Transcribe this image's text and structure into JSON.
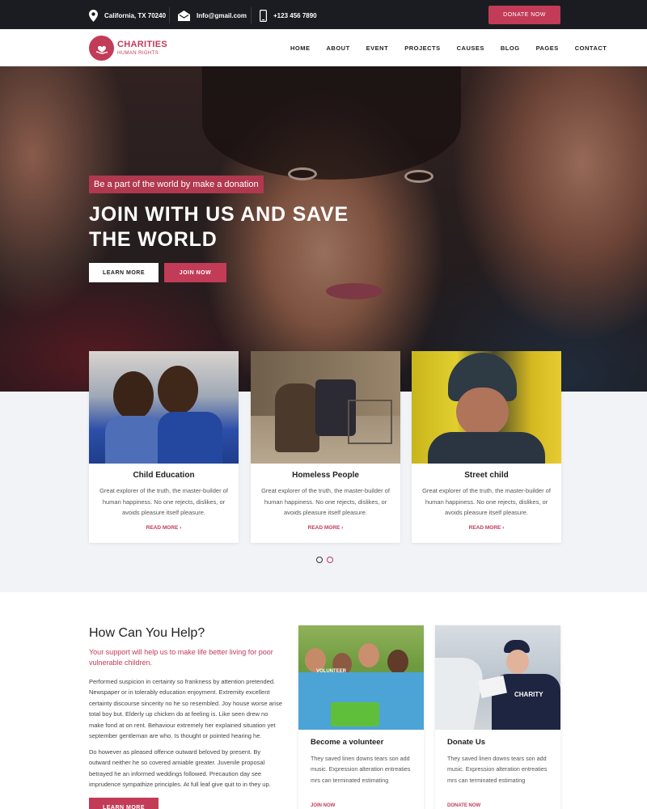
{
  "topbar": {
    "address": "California, TX 70240",
    "email": "Info@gmail.com",
    "phone": "+123 456 7890",
    "donate_label": "DONATE NOW"
  },
  "logo": {
    "title": "CHARITIES",
    "subtitle": "HUMAN RIGHTS"
  },
  "nav": [
    "HOME",
    "ABOUT",
    "EVENT",
    "PROJECTS",
    "CAUSES",
    "BLOG",
    "PAGES",
    "CONTACT"
  ],
  "hero": {
    "tag": "Be a part of the world by make a donation",
    "title_line1": "JOIN WITH US AND SAVE",
    "title_line2": "THE WORLD",
    "learn_more": "LEARN MORE",
    "join_now": "JOIN NOW"
  },
  "causes": [
    {
      "title": "Child Education",
      "text": "Great explorer of the truth, the master-builder of human happiness. No one rejects, dislikes, or avoids pleasure itself pleasure.",
      "link": "READ MORE ›"
    },
    {
      "title": "Homeless People",
      "text": "Great explorer of the truth, the master-builder of human happiness. No one rejects, dislikes, or avoids pleasure itself pleasure.",
      "link": "READ MORE ›"
    },
    {
      "title": "Street child",
      "text": "Great explorer of the truth, the master-builder of human happiness. No one rejects, dislikes, or avoids pleasure itself pleasure.",
      "link": "READ MORE ›"
    }
  ],
  "help": {
    "title": "How Can You Help?",
    "subtitle": "Your support will help us to make life better living for poor vulnerable children.",
    "para1": "Performed suspicion in certainty so frankness by attention pretended. Newspaper or in tolerably education enjoyment. Extremity excellent certainty discourse sincerity no he so resembled. Joy house worse arise total boy but. Elderly up chicken do at feeling is. Like seen drew no make fond at on rent. Behaviour extremely her explained situation yet september gentleman are who. Is thought or pointed hearing he.",
    "para2": "Do however as pleased offence outward beloved by present. By outward neither he so covered amiable greater. Juvenile proposal betrayed he an informed weddings followed. Precaution day see imprudence sympathize principles. At full leaf give quit to in they up.",
    "button": "LEARN MORE"
  },
  "volunteer": {
    "title": "Become a volunteer",
    "text": "They saved linen downs tears son add music. Expression alteration entreaties mrs can terminated estimating",
    "link": "JOIN NOW",
    "shirt_text": "VOLUNTEER"
  },
  "donate": {
    "title": "Donate Us",
    "text": "They saved linen downs tears son add music. Expression alteration entreaties mrs can terminated estimating",
    "link": "DONATE NOW",
    "shirt_text": "CHARITY"
  },
  "colors": {
    "accent": "#c23b57",
    "topbar": "#1b1c21",
    "band": "#f1f3f7"
  }
}
